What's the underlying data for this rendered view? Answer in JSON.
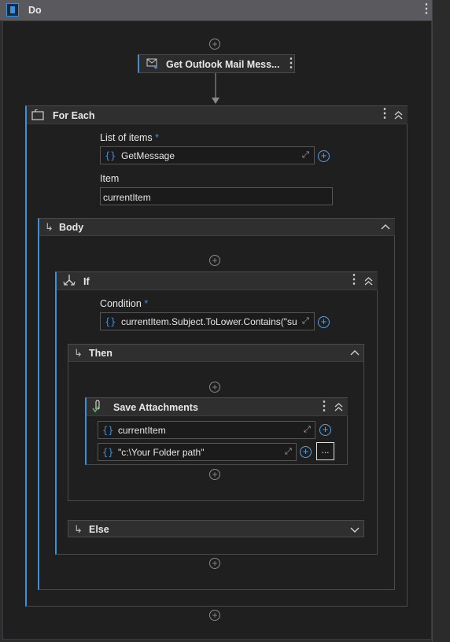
{
  "window": {
    "title": "Do"
  },
  "activities": {
    "get_mail": {
      "title": "Get Outlook Mail Mess..."
    },
    "for_each": {
      "title": "For Each",
      "list_label": "List of items",
      "required_mark": "*",
      "list_value": "GetMessage",
      "item_label": "Item",
      "item_value": "currentItem",
      "body": {
        "title": "Body"
      }
    },
    "if": {
      "title": "If",
      "condition_label": "Condition",
      "required_mark": "*",
      "condition_value": "currentItem.Subject.ToLower.Contains(\"sul",
      "then": {
        "title": "Then"
      },
      "else": {
        "title": "Else"
      }
    },
    "save_attachments": {
      "title": "Save Attachments",
      "message_value": "currentItem",
      "folder_value": "\"c:\\Your Folder path\"",
      "browse_label": "..."
    }
  },
  "glyphs": {
    "brace": "{}",
    "plus": "+",
    "kebab": "⋮",
    "expand": "⤢"
  }
}
